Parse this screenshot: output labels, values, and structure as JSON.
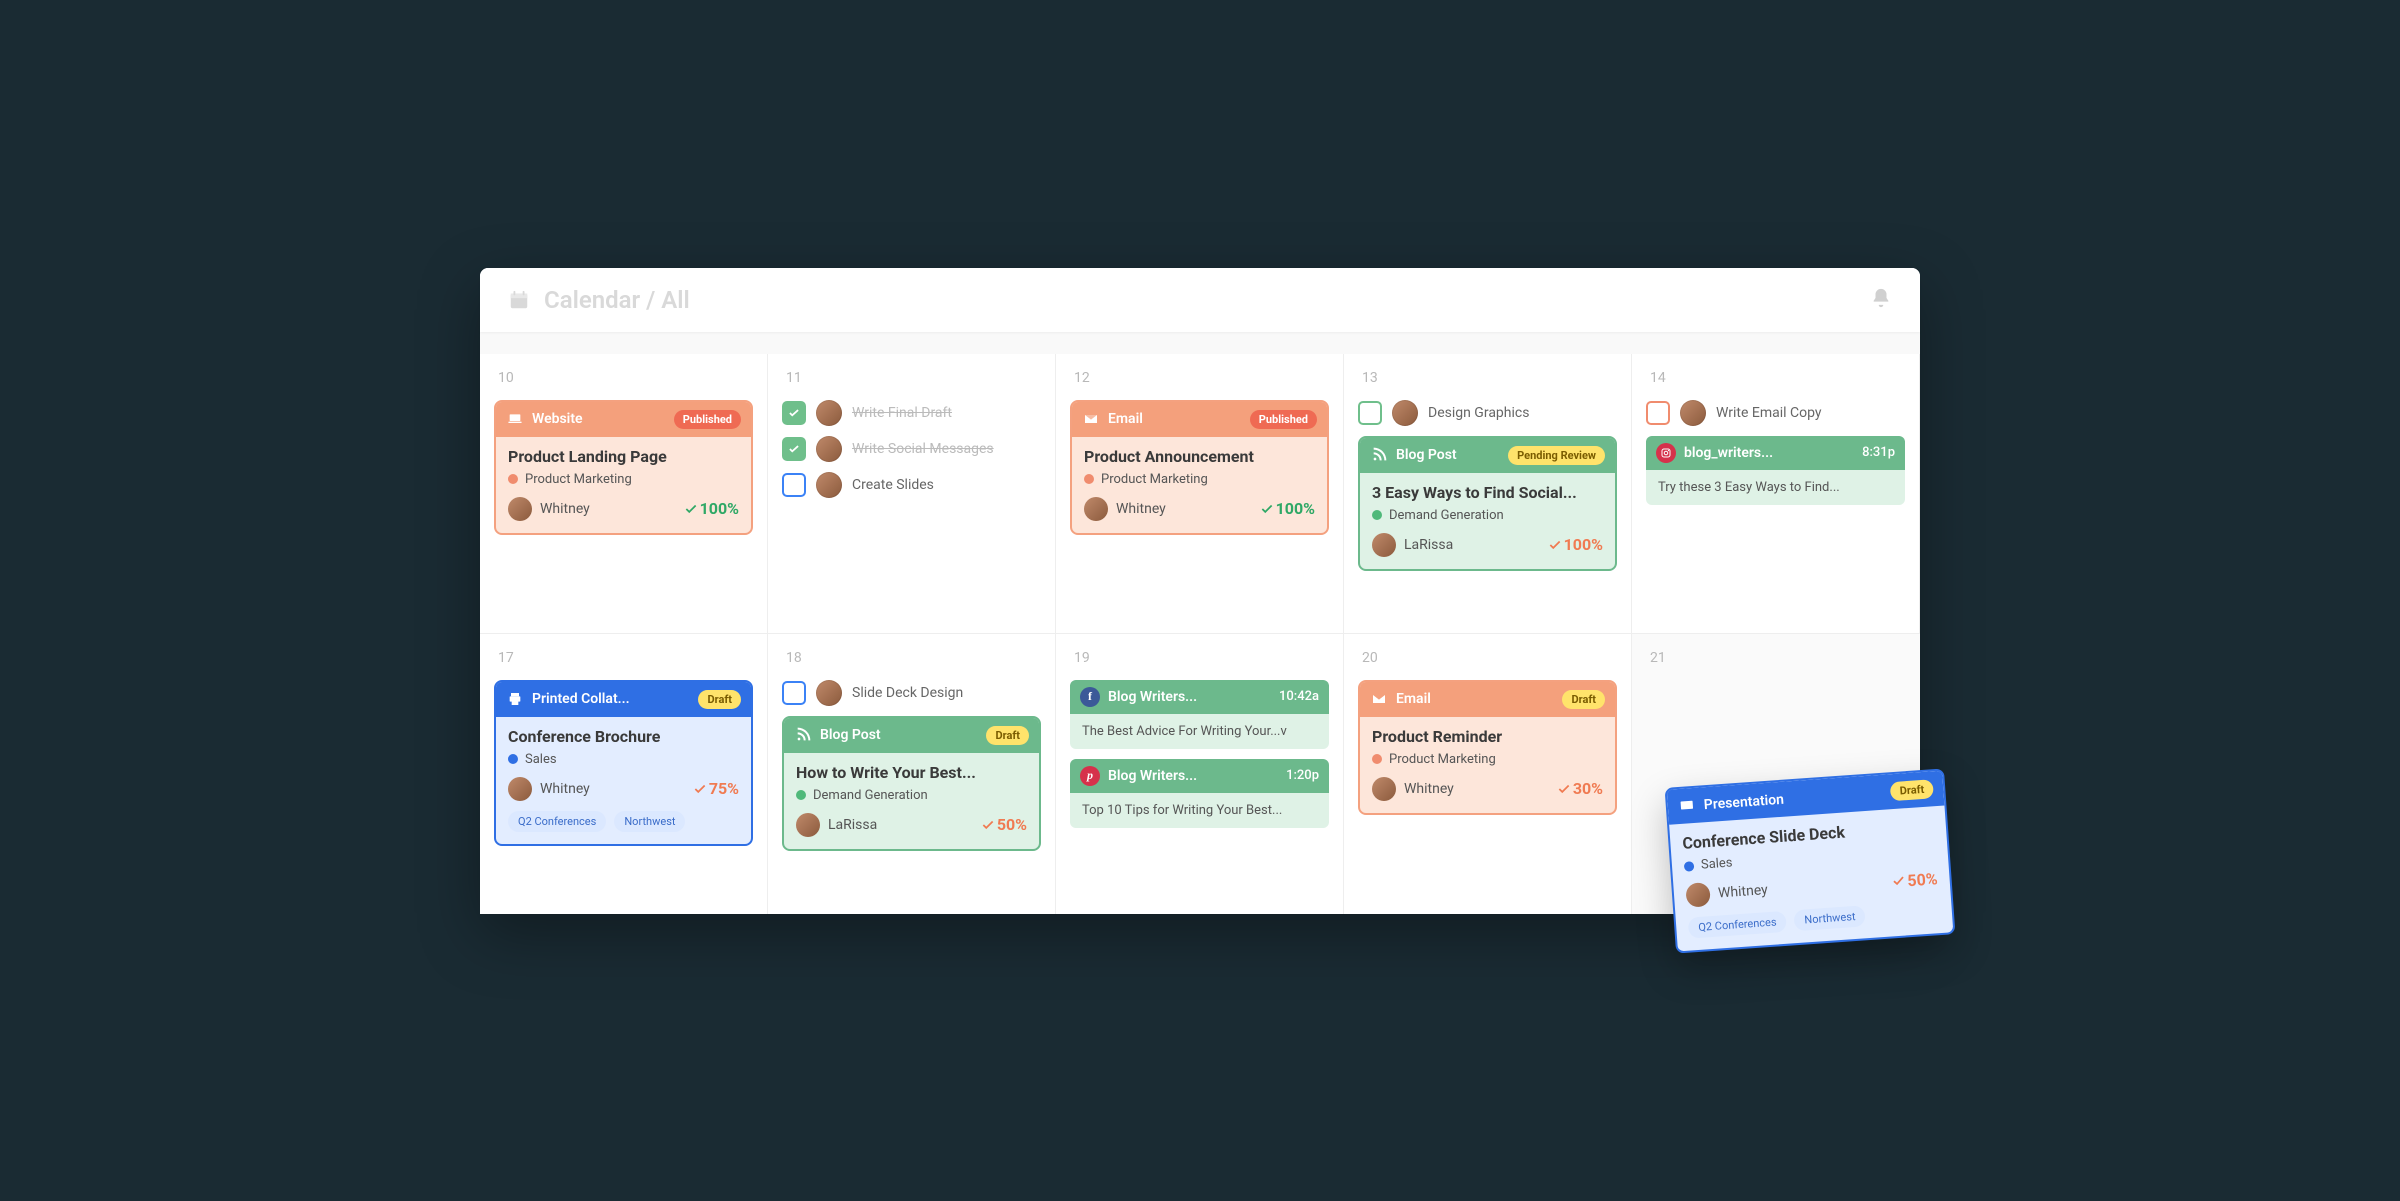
{
  "header": {
    "breadcrumb": "Calendar / All"
  },
  "status": {
    "published": "Published",
    "pending": "Pending Review",
    "draft": "Draft"
  },
  "types": {
    "website": "Website",
    "email": "Email",
    "blog": "Blog Post",
    "printed": "Printed Collat...",
    "presentation": "Presentation",
    "blogwriters": "Blog Writers...",
    "ig": "blog_writers..."
  },
  "days": {
    "d10": {
      "num": "10",
      "card": {
        "title": "Product Landing Page",
        "category": "Product Marketing",
        "assignee": "Whitney",
        "pct": "100%"
      }
    },
    "d11": {
      "num": "11",
      "tasks": [
        {
          "label": "Write Final Draft",
          "done": true
        },
        {
          "label": "Write Social Messages",
          "done": true
        },
        {
          "label": "Create Slides",
          "done": false,
          "box": "blue"
        }
      ]
    },
    "d12": {
      "num": "12",
      "card": {
        "title": "Product Announcement",
        "category": "Product Marketing",
        "assignee": "Whitney",
        "pct": "100%"
      }
    },
    "d13": {
      "num": "13",
      "task": {
        "label": "Design Graphics",
        "box": "green"
      },
      "card": {
        "title": "3 Easy Ways to Find Social...",
        "category": "Demand Generation",
        "assignee": "LaRissa",
        "pct": "100%"
      }
    },
    "d14": {
      "num": "14",
      "task": {
        "label": "Write Email Copy",
        "box": "orange"
      },
      "mini": {
        "time": "8:31p",
        "snippet": "Try these 3 Easy Ways to Find..."
      }
    },
    "d17": {
      "num": "17",
      "card": {
        "title": "Conference Brochure",
        "category": "Sales",
        "assignee": "Whitney",
        "pct": "75%",
        "tags": [
          "Q2 Conferences",
          "Northwest"
        ]
      }
    },
    "d18": {
      "num": "18",
      "task": {
        "label": "Slide Deck Design",
        "box": "blue"
      },
      "card": {
        "title": "How to Write Your Best...",
        "category": "Demand Generation",
        "assignee": "LaRissa",
        "pct": "50%"
      }
    },
    "d19": {
      "num": "19",
      "m1": {
        "time": "10:42a",
        "snippet": "The Best Advice For Writing Your...v"
      },
      "m2": {
        "time": "1:20p",
        "snippet": "Top 10 Tips for Writing Your Best..."
      }
    },
    "d20": {
      "num": "20",
      "card": {
        "title": "Product Reminder",
        "category": "Product Marketing",
        "assignee": "Whitney",
        "pct": "30%"
      }
    },
    "d21": {
      "num": "21"
    }
  },
  "floating": {
    "title": "Conference Slide Deck",
    "category": "Sales",
    "assignee": "Whitney",
    "pct": "50%",
    "tags": [
      "Q2 Conferences",
      "Northwest"
    ]
  }
}
